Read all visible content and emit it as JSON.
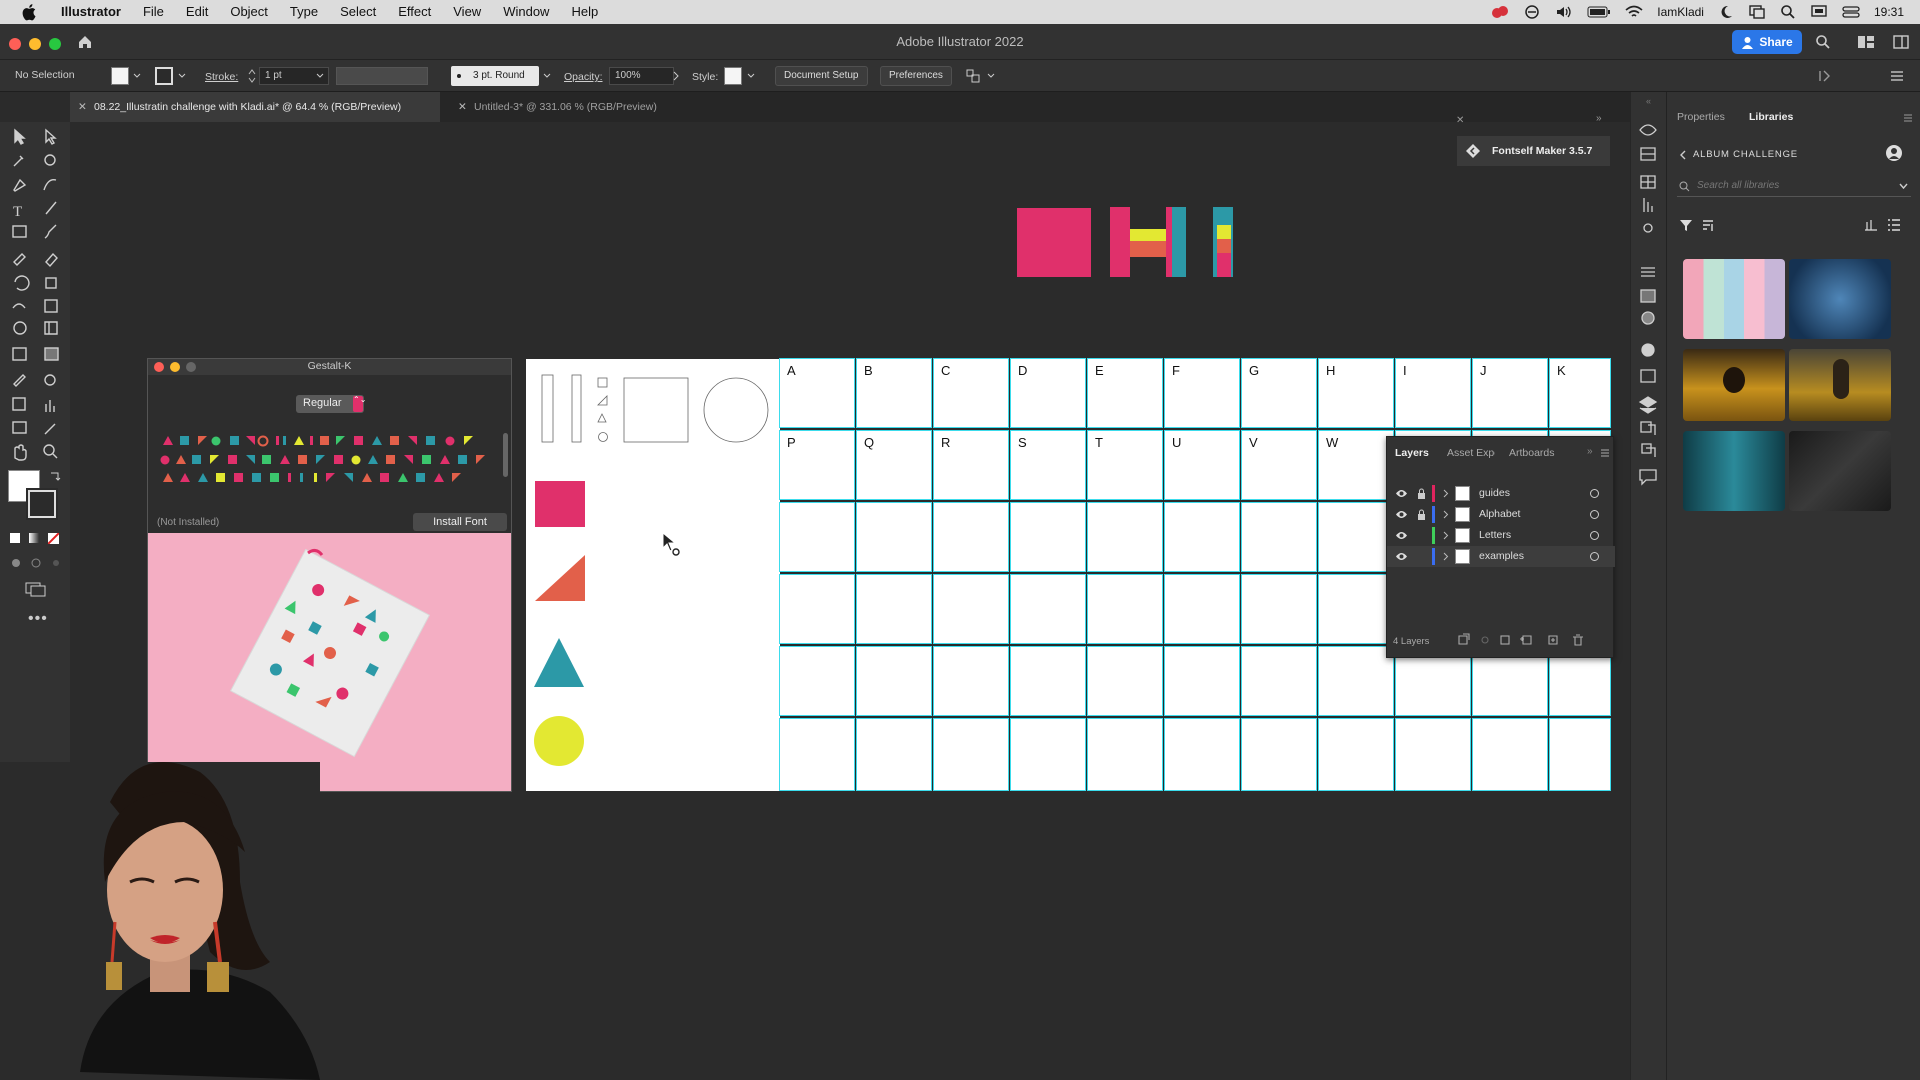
{
  "menubar": {
    "app_name": "Illustrator",
    "items": [
      "File",
      "Edit",
      "Object",
      "Type",
      "Select",
      "Effect",
      "View",
      "Window",
      "Help"
    ],
    "user": "IamKladi",
    "clock": "19:31"
  },
  "window": {
    "title": "Adobe Illustrator 2022",
    "share_label": "Share"
  },
  "control_bar": {
    "selection": "No Selection",
    "stroke_label": "Stroke:",
    "stroke_value": "1 pt",
    "brush_value": "3 pt. Round",
    "opacity_label": "Opacity:",
    "opacity_value": "100%",
    "style_label": "Style:",
    "document_setup": "Document Setup",
    "preferences": "Preferences"
  },
  "tabs": [
    {
      "label": "08.22_Illustratin challenge with Kladi.ai* @ 64.4 % (RGB/Preview)",
      "active": true
    },
    {
      "label": "Untitled-3* @ 331.06 % (RGB/Preview)",
      "active": false
    }
  ],
  "fontself": {
    "label": "Fontself Maker 3.5.7"
  },
  "gestalt_panel": {
    "title": "Gestalt-K",
    "style_value": "Regular",
    "status": "(Not Installed)",
    "install_button": "Install Font"
  },
  "artboard": {
    "row1_letters": [
      "A",
      "B",
      "C",
      "D",
      "E",
      "F",
      "G",
      "H",
      "I",
      "J",
      "K"
    ],
    "row2_letters": [
      "P",
      "Q",
      "R",
      "S",
      "T",
      "U",
      "V",
      "W"
    ]
  },
  "layers_panel": {
    "tabs": [
      "Layers",
      "Asset Expo",
      "Artboards"
    ],
    "layers": [
      {
        "name": "guides",
        "color": "#e0245e",
        "locked": true
      },
      {
        "name": "Alphabet",
        "color": "#3a6df0",
        "locked": true
      },
      {
        "name": "Letters",
        "color": "#3fcf5a",
        "locked": false
      },
      {
        "name": "examples",
        "color": "#3a6df0",
        "locked": false
      }
    ],
    "footer_count": "4 Layers"
  },
  "libraries_panel": {
    "tabs": [
      "Properties",
      "Libraries"
    ],
    "active_tab": "Libraries",
    "library_name": "ALBUM CHALLENGE",
    "search_placeholder": "Search all libraries"
  },
  "colors": {
    "pink": "#e0306b",
    "coral": "#e2604a",
    "teal": "#2c99a7",
    "yellow": "#e3e832",
    "guide_cyan": "#3bdcec",
    "accent_blue": "#2b77e8"
  }
}
